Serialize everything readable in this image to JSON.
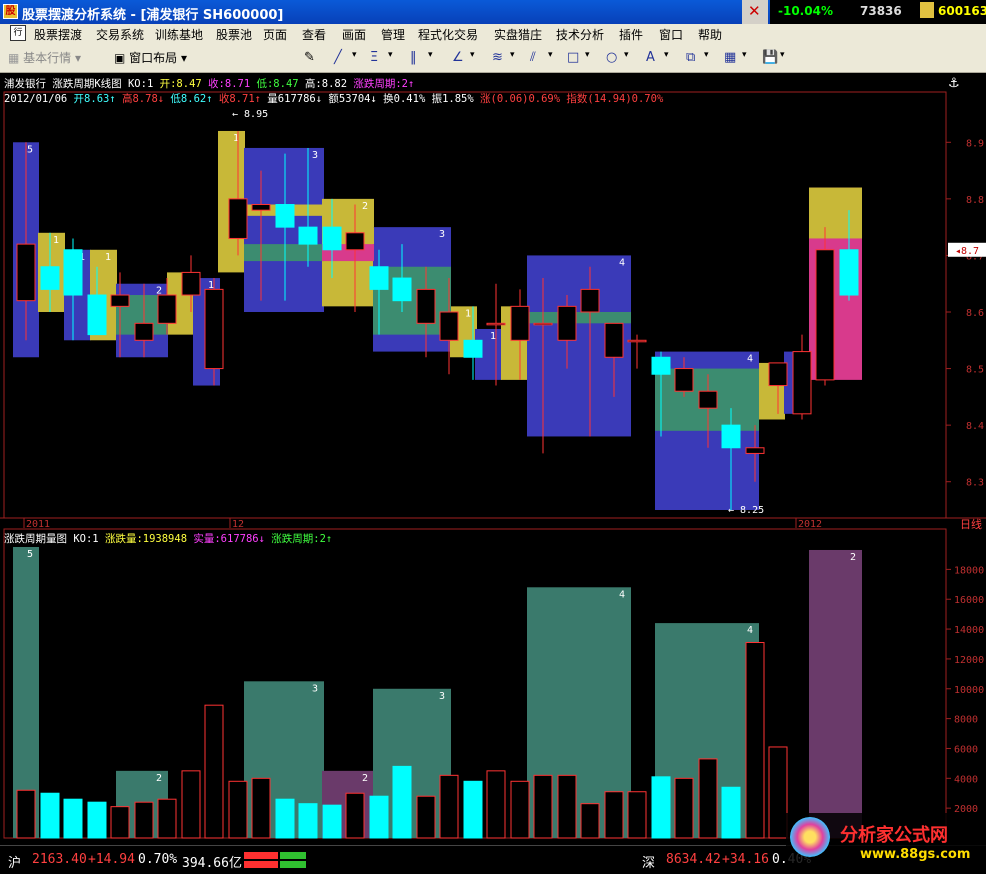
{
  "window": {
    "title": "股票摆渡分析系统 - [浦发银行  SH600000]",
    "top_right": {
      "change": "-10.04%",
      "value1": "73836",
      "code": "600163",
      "watermark": "www.88gs.com"
    }
  },
  "menu": [
    "股票摆渡",
    "交易系统",
    "训练基地",
    "股票池",
    "页面",
    "查看",
    "画面",
    "管理",
    "程式化交易",
    "实盘猎庄",
    "技术分析",
    "插件",
    "窗口",
    "帮助"
  ],
  "toolbar": {
    "market_label": "基本行情",
    "layout_label": "窗口布局"
  },
  "kline": {
    "header": {
      "stock": "浦发银行",
      "chart_name": "涨跌周期K线图",
      "ko": "KO:1",
      "open": "开:8.47",
      "close": "收:8.71",
      "low": "低:8.47",
      "high": "高:8.82",
      "cycle": "涨跌周期:2↑"
    },
    "info_line": {
      "date": "2012/01/06",
      "open": "开8.63↑",
      "high": "高8.78↓",
      "low": "低8.62↑",
      "close": "收8.71↑",
      "vol": "量617786↓",
      "amount": "额53704↓",
      "turnover": "换0.41%",
      "amplitude": "振1.85%",
      "chg": "涨(0.06)0.69%",
      "index": "指数(14.94)0.70%"
    },
    "price_labels": [
      "8.9",
      "8.8",
      "8.7",
      "8.6",
      "8.5",
      "8.4",
      "8.3"
    ],
    "price_values": [
      8.9,
      8.8,
      8.7,
      8.6,
      8.5,
      8.4,
      8.3
    ],
    "current_price": "8.7",
    "high_marker": "8.95",
    "low_marker": "8.25",
    "date_labels": [
      "2011",
      "12",
      "2012"
    ],
    "period_button": "日线"
  },
  "volume": {
    "header": {
      "name": "涨跌周期量图",
      "ko": "KO:1",
      "cycle_vol": "涨跌量:1938948",
      "real_vol": "实量:617786↓",
      "cycle": "涨跌周期:2↑"
    },
    "axis_labels": [
      "18000",
      "16000",
      "14000",
      "12000",
      "10000",
      "8000",
      "6000",
      "4000",
      "2000"
    ],
    "axis_values": [
      18000,
      16000,
      14000,
      12000,
      10000,
      8000,
      6000,
      4000,
      2000
    ]
  },
  "colors": {
    "up": "#ff3333",
    "down": "#00ffff",
    "yellow_box": "#c8b838",
    "blue_box": "#3a3ab8",
    "green_box": "#3c8c70",
    "pink_box": "#d83a8c",
    "vol_green": "#3a7a6c",
    "vol_purple": "#6a3a6a"
  },
  "status": {
    "sh_label": "沪",
    "sh_index": "2163.40",
    "sh_chg": "+14.94",
    "sh_pct": "0.70%",
    "sh_amount": "394.66亿",
    "sz_label": "深",
    "sz_index": "8634.42",
    "sz_chg": "+34.16",
    "sz_pct": "0.40%",
    "brand": "分析家公式网",
    "brand_url": "www.88gs.com"
  },
  "chart_data": {
    "type": "candlestick",
    "ylim": [
      8.25,
      8.95
    ],
    "candles": [
      {
        "o": 8.62,
        "h": 8.9,
        "l": 8.55,
        "c": 8.72
      },
      {
        "o": 8.68,
        "h": 8.74,
        "l": 8.6,
        "c": 8.64
      },
      {
        "o": 8.71,
        "h": 8.73,
        "l": 8.55,
        "c": 8.63
      },
      {
        "o": 8.63,
        "h": 8.68,
        "l": 8.56,
        "c": 8.56
      },
      {
        "o": 8.61,
        "h": 8.67,
        "l": 8.52,
        "c": 8.63
      },
      {
        "o": 8.55,
        "h": 8.65,
        "l": 8.52,
        "c": 8.58
      },
      {
        "o": 8.58,
        "h": 8.66,
        "l": 8.56,
        "c": 8.63
      },
      {
        "o": 8.63,
        "h": 8.7,
        "l": 8.6,
        "c": 8.67
      },
      {
        "o": 8.5,
        "h": 8.66,
        "l": 8.47,
        "c": 8.64
      },
      {
        "o": 8.73,
        "h": 8.92,
        "l": 8.7,
        "c": 8.8
      },
      {
        "o": 8.78,
        "h": 8.85,
        "l": 8.62,
        "c": 8.79
      },
      {
        "o": 8.79,
        "h": 8.88,
        "l": 8.62,
        "c": 8.75
      },
      {
        "o": 8.75,
        "h": 8.89,
        "l": 8.68,
        "c": 8.72
      },
      {
        "o": 8.75,
        "h": 8.8,
        "l": 8.66,
        "c": 8.71
      },
      {
        "o": 8.71,
        "h": 8.79,
        "l": 8.6,
        "c": 8.74
      },
      {
        "o": 8.68,
        "h": 8.71,
        "l": 8.56,
        "c": 8.64
      },
      {
        "o": 8.66,
        "h": 8.72,
        "l": 8.6,
        "c": 8.62
      },
      {
        "o": 8.58,
        "h": 8.68,
        "l": 8.52,
        "c": 8.64
      },
      {
        "o": 8.55,
        "h": 8.66,
        "l": 8.49,
        "c": 8.6
      },
      {
        "o": 8.55,
        "h": 8.61,
        "l": 8.48,
        "c": 8.52
      },
      {
        "o": 8.58,
        "h": 8.65,
        "l": 8.47,
        "c": 8.58
      },
      {
        "o": 8.55,
        "h": 8.64,
        "l": 8.48,
        "c": 8.61
      },
      {
        "o": 8.58,
        "h": 8.66,
        "l": 8.35,
        "c": 8.58
      },
      {
        "o": 8.55,
        "h": 8.63,
        "l": 8.5,
        "c": 8.61
      },
      {
        "o": 8.6,
        "h": 8.68,
        "l": 8.38,
        "c": 8.64
      },
      {
        "o": 8.52,
        "h": 8.58,
        "l": 8.45,
        "c": 8.58
      },
      {
        "o": 8.55,
        "h": 8.56,
        "l": 8.5,
        "c": 8.55
      },
      {
        "o": 8.52,
        "h": 8.53,
        "l": 8.38,
        "c": 8.49
      },
      {
        "o": 8.46,
        "h": 8.52,
        "l": 8.45,
        "c": 8.5
      },
      {
        "o": 8.43,
        "h": 8.49,
        "l": 8.36,
        "c": 8.46
      },
      {
        "o": 8.4,
        "h": 8.43,
        "l": 8.25,
        "c": 8.36
      },
      {
        "o": 8.35,
        "h": 8.4,
        "l": 8.3,
        "c": 8.36
      },
      {
        "o": 8.47,
        "h": 8.5,
        "l": 8.42,
        "c": 8.51
      },
      {
        "o": 8.42,
        "h": 8.56,
        "l": 8.41,
        "c": 8.53
      },
      {
        "o": 8.48,
        "h": 8.75,
        "l": 8.47,
        "c": 8.71
      },
      {
        "o": 8.71,
        "h": 8.78,
        "l": 8.62,
        "c": 8.63
      }
    ]
  }
}
